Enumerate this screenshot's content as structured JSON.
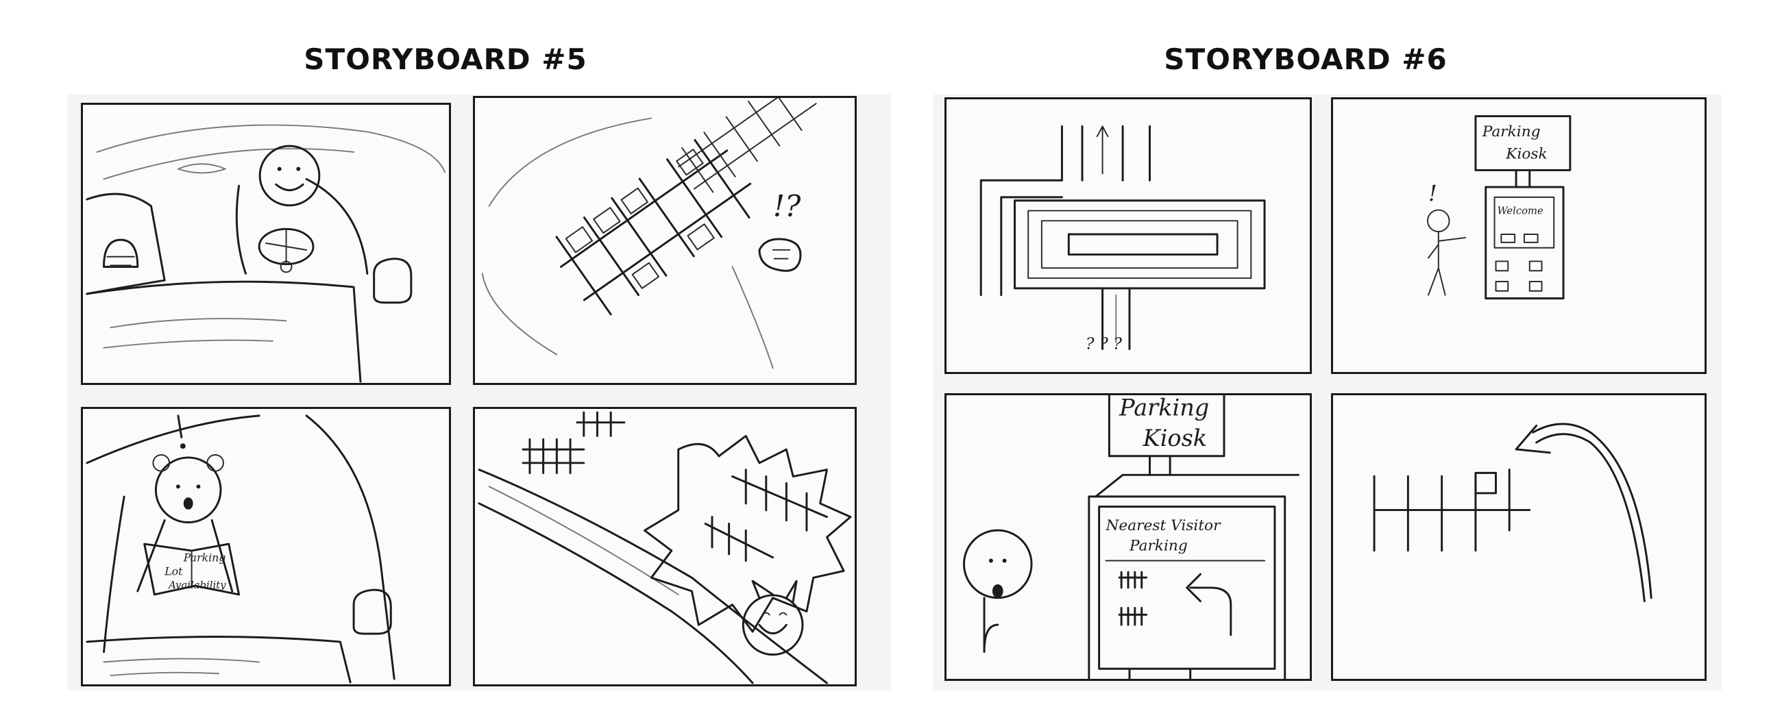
{
  "storyboards": [
    {
      "title": "STORYBOARD #5",
      "panels": [
        {
          "id": "5-1"
        },
        {
          "id": "5-2",
          "exclaim": "!?"
        },
        {
          "id": "5-3",
          "exclaim": "!",
          "paper_text": [
            "Parking",
            "Lot",
            "Availability"
          ]
        },
        {
          "id": "5-4"
        }
      ]
    },
    {
      "title": "STORYBOARD #6",
      "panels": [
        {
          "id": "6-1",
          "marks": "? ? ?"
        },
        {
          "id": "6-2",
          "exclaim": "!",
          "sign_text": [
            "Parking",
            "Kiosk"
          ],
          "screen_text": "Welcome"
        },
        {
          "id": "6-3",
          "sign_text": [
            "Parking",
            "Kiosk"
          ],
          "screen_title": [
            "Nearest Visitor",
            "Parking"
          ]
        },
        {
          "id": "6-4"
        }
      ]
    }
  ],
  "colors": {
    "ink": "#1c1c1c",
    "paper": "#f4f4f4",
    "panel": "#fbfbfb"
  }
}
